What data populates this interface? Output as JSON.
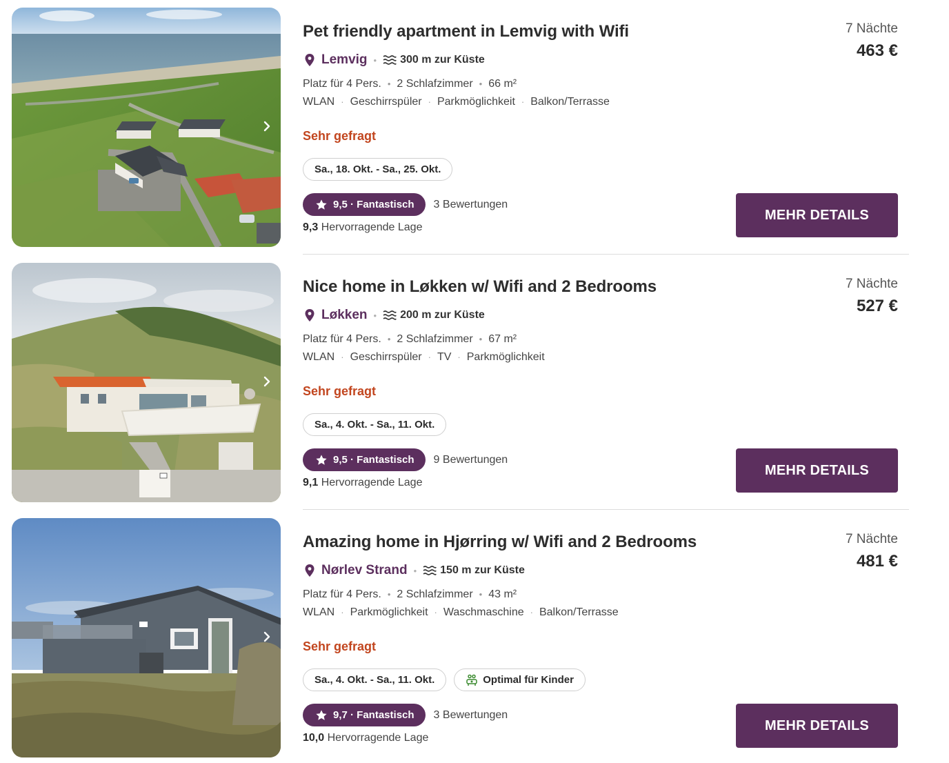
{
  "colors": {
    "brand_purple": "#5c2f5e",
    "demand_orange": "#c2461f",
    "kids_green": "#3a8a2e"
  },
  "listings": [
    {
      "title": "Pet friendly apartment in Lemvig with Wifi",
      "location": "Lemvig",
      "coast_distance": "300 m zur Küste",
      "facts": [
        "Platz für 4 Pers.",
        "2 Schlafzimmer",
        "66 m²"
      ],
      "amenities": [
        "WLAN",
        "Geschirrspüler",
        "Parkmöglichkeit",
        "Balkon/Terrasse"
      ],
      "demand": "Sehr gefragt",
      "dates": "Sa., 18. Okt. - Sa., 25. Okt.",
      "badge": "",
      "rating": "9,5 · Fantastisch",
      "reviews": "3 Bewertungen",
      "location_score": "9,3",
      "location_label": "Hervorragende Lage",
      "nights": "7 Nächte",
      "price": "463 €",
      "button": "MEHR DETAILS",
      "photo_icon": "photo-next-chevron-icon"
    },
    {
      "title": "Nice home in Løkken w/ Wifi and 2 Bedrooms",
      "location": "Løkken",
      "coast_distance": "200 m zur Küste",
      "facts": [
        "Platz für 4 Pers.",
        "2 Schlafzimmer",
        "67 m²"
      ],
      "amenities": [
        "WLAN",
        "Geschirrspüler",
        "TV",
        "Parkmöglichkeit"
      ],
      "demand": "Sehr gefragt",
      "dates": "Sa., 4. Okt. - Sa., 11. Okt.",
      "badge": "",
      "rating": "9,5 · Fantastisch",
      "reviews": "9 Bewertungen",
      "location_score": "9,1",
      "location_label": "Hervorragende Lage",
      "nights": "7 Nächte",
      "price": "527 €",
      "button": "MEHR DETAILS",
      "photo_icon": "photo-next-chevron-icon"
    },
    {
      "title": "Amazing home in Hjørring w/ Wifi and 2 Bedrooms",
      "location": "Nørlev Strand",
      "coast_distance": "150 m zur Küste",
      "facts": [
        "Platz für 4 Pers.",
        "2 Schlafzimmer",
        "43 m²"
      ],
      "amenities": [
        "WLAN",
        "Parkmöglichkeit",
        "Waschmaschine",
        "Balkon/Terrasse"
      ],
      "demand": "Sehr gefragt",
      "dates": "Sa., 4. Okt. - Sa., 11. Okt.",
      "badge": "Optimal für Kinder",
      "rating": "9,7 · Fantastisch",
      "reviews": "3 Bewertungen",
      "location_score": "10,0",
      "location_label": "Hervorragende Lage",
      "nights": "7 Nächte",
      "price": "481 €",
      "button": "MEHR DETAILS",
      "photo_icon": "photo-next-chevron-icon"
    }
  ]
}
